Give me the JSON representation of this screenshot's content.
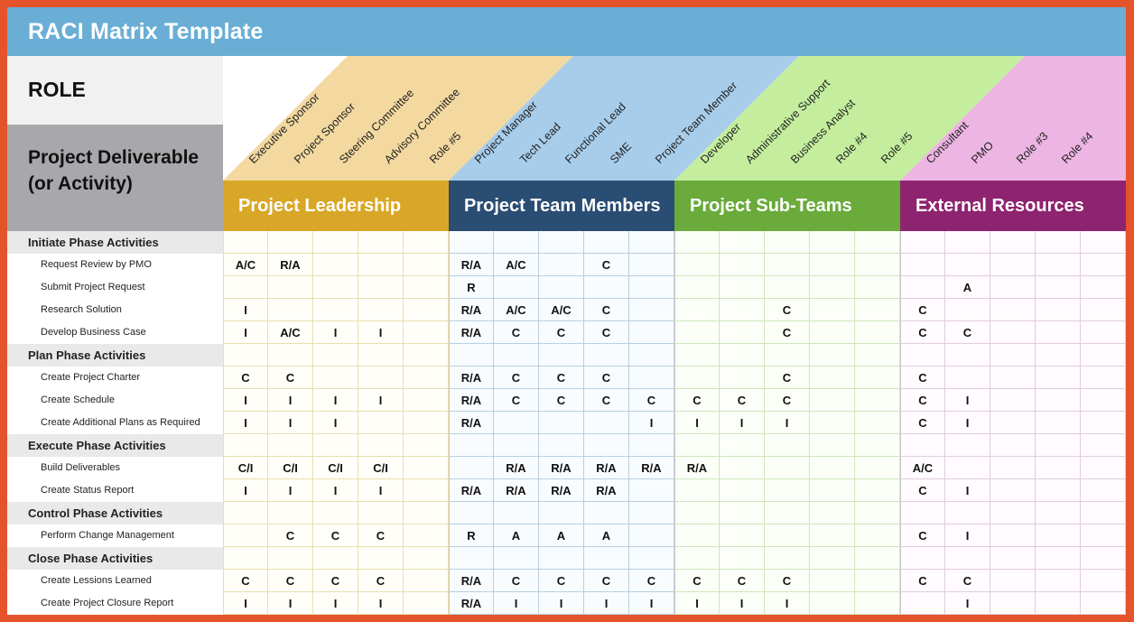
{
  "title": "RACI Matrix Template",
  "header": {
    "role_label": "ROLE",
    "deliverable_label_line1": "Project Deliverable",
    "deliverable_label_line2": "(or Activity)"
  },
  "groups": [
    {
      "name": "Project Leadership",
      "band_color": "#d9a727",
      "diag_color": "#f3d9a0",
      "roles": [
        "Executive Sponsor",
        "Project Sponsor",
        "Steering Committee",
        "Advisory Committee",
        "Role #5"
      ]
    },
    {
      "name": "Project Team Members",
      "band_color": "#2a4d74",
      "diag_color": "#a8cdeb",
      "roles": [
        "Project Manager",
        "Tech Lead",
        "Functional Lead",
        "SME",
        "Project Team Member"
      ]
    },
    {
      "name": "Project Sub-Teams",
      "band_color": "#6aab3b",
      "diag_color": "#c4ee9e",
      "roles": [
        "Developer",
        "Administrative Support",
        "Business Analyst",
        "Role #4",
        "Role #5"
      ]
    },
    {
      "name": "External Resources",
      "band_color": "#8e2470",
      "diag_color": "#edb5e3",
      "roles": [
        "Consultant",
        "PMO",
        "Role #3",
        "Role #4"
      ]
    }
  ],
  "rows": [
    {
      "type": "phase",
      "label": "Initiate Phase Activities",
      "cells": [
        "",
        "",
        "",
        "",
        "",
        "",
        "",
        "",
        "",
        "",
        "",
        "",
        "",
        "",
        "",
        "",
        "",
        "",
        "",
        ""
      ]
    },
    {
      "type": "task",
      "label": "Request Review by PMO",
      "cells": [
        "A/C",
        "R/A",
        "",
        "",
        "",
        "R/A",
        "A/C",
        "",
        "C",
        "",
        "",
        "",
        "",
        "",
        "",
        "",
        "",
        "",
        "",
        ""
      ]
    },
    {
      "type": "task",
      "label": "Submit Project Request",
      "cells": [
        "",
        "",
        "",
        "",
        "",
        "R",
        "",
        "",
        "",
        "",
        "",
        "",
        "",
        "",
        "",
        "",
        "A",
        "",
        "",
        ""
      ]
    },
    {
      "type": "task",
      "label": "Research Solution",
      "cells": [
        "I",
        "",
        "",
        "",
        "",
        "R/A",
        "A/C",
        "A/C",
        "C",
        "",
        "",
        "",
        "C",
        "",
        "",
        "C",
        "",
        "",
        "",
        ""
      ]
    },
    {
      "type": "task",
      "label": "Develop Business Case",
      "cells": [
        "I",
        "A/C",
        "I",
        "I",
        "",
        "R/A",
        "C",
        "C",
        "C",
        "",
        "",
        "",
        "C",
        "",
        "",
        "C",
        "C",
        "",
        "",
        ""
      ]
    },
    {
      "type": "phase",
      "label": "Plan Phase Activities",
      "cells": [
        "",
        "",
        "",
        "",
        "",
        "",
        "",
        "",
        "",
        "",
        "",
        "",
        "",
        "",
        "",
        "",
        "",
        "",
        "",
        ""
      ]
    },
    {
      "type": "task",
      "label": "Create Project Charter",
      "cells": [
        "C",
        "C",
        "",
        "",
        "",
        "R/A",
        "C",
        "C",
        "C",
        "",
        "",
        "",
        "C",
        "",
        "",
        "C",
        "",
        "",
        "",
        ""
      ]
    },
    {
      "type": "task",
      "label": "Create Schedule",
      "cells": [
        "I",
        "I",
        "I",
        "I",
        "",
        "R/A",
        "C",
        "C",
        "C",
        "C",
        "C",
        "C",
        "C",
        "",
        "",
        "C",
        "I",
        "",
        "",
        ""
      ]
    },
    {
      "type": "task",
      "label": "Create Additional Plans as Required",
      "cells": [
        "I",
        "I",
        "I",
        "",
        "",
        "R/A",
        "",
        "",
        "",
        "I",
        "I",
        "I",
        "I",
        "",
        "",
        "C",
        "I",
        "",
        "",
        ""
      ]
    },
    {
      "type": "phase",
      "label": "Execute Phase Activities",
      "cells": [
        "",
        "",
        "",
        "",
        "",
        "",
        "",
        "",
        "",
        "",
        "",
        "",
        "",
        "",
        "",
        "",
        "",
        "",
        "",
        ""
      ]
    },
    {
      "type": "task",
      "label": "Build Deliverables",
      "cells": [
        "C/I",
        "C/I",
        "C/I",
        "C/I",
        "",
        "",
        "R/A",
        "R/A",
        "R/A",
        "R/A",
        "R/A",
        "",
        "",
        "",
        "",
        "A/C",
        "",
        "",
        "",
        ""
      ]
    },
    {
      "type": "task",
      "label": "Create Status Report",
      "cells": [
        "I",
        "I",
        "I",
        "I",
        "",
        "R/A",
        "R/A",
        "R/A",
        "R/A",
        "",
        "",
        "",
        "",
        "",
        "",
        "C",
        "I",
        "",
        "",
        ""
      ]
    },
    {
      "type": "phase",
      "label": "Control Phase Activities",
      "cells": [
        "",
        "",
        "",
        "",
        "",
        "",
        "",
        "",
        "",
        "",
        "",
        "",
        "",
        "",
        "",
        "",
        "",
        "",
        "",
        ""
      ]
    },
    {
      "type": "task",
      "label": "Perform Change Management",
      "cells": [
        "",
        "C",
        "C",
        "C",
        "",
        "R",
        "A",
        "A",
        "A",
        "",
        "",
        "",
        "",
        "",
        "",
        "C",
        "I",
        "",
        "",
        ""
      ]
    },
    {
      "type": "phase",
      "label": "Close Phase Activities",
      "cells": [
        "",
        "",
        "",
        "",
        "",
        "",
        "",
        "",
        "",
        "",
        "",
        "",
        "",
        "",
        "",
        "",
        "",
        "",
        "",
        ""
      ]
    },
    {
      "type": "task",
      "label": "Create Lessions Learned",
      "cells": [
        "C",
        "C",
        "C",
        "C",
        "",
        "R/A",
        "C",
        "C",
        "C",
        "C",
        "C",
        "C",
        "C",
        "",
        "",
        "C",
        "C",
        "",
        "",
        ""
      ]
    },
    {
      "type": "task",
      "label": "Create Project Closure Report",
      "cells": [
        "I",
        "I",
        "I",
        "I",
        "",
        "R/A",
        "I",
        "I",
        "I",
        "I",
        "I",
        "I",
        "I",
        "",
        "",
        "",
        "I",
        "",
        "",
        ""
      ]
    }
  ]
}
